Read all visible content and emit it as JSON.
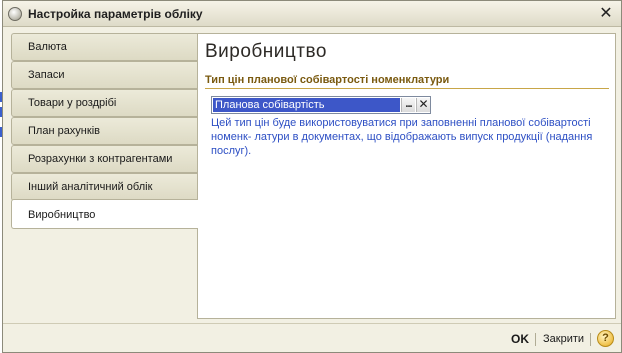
{
  "window": {
    "title": "Настройка параметрів обліку",
    "close_glyph": "✕",
    "app_icon": "app-logo-icon"
  },
  "tabs": [
    {
      "label": "Валюта"
    },
    {
      "label": "Запаси"
    },
    {
      "label": "Товари у роздрібі"
    },
    {
      "label": "План рахунків"
    },
    {
      "label": "Розрахунки з контрагентами"
    },
    {
      "label": "Інший аналітичний облік"
    },
    {
      "label": "Виробництво"
    }
  ],
  "active_tab_index": 6,
  "panel": {
    "title": "Виробництво",
    "group_header": "Тип цін планової собівартості номенклатури",
    "field_value": "Планова собівартість",
    "select_glyph": "...",
    "clear_glyph": "✕",
    "hint": "Цей тип цін буде використовуватися при заповненні планової собівартості номенк- латури в документах, що відображають випуск продукції (надання послуг)."
  },
  "footer": {
    "ok_label": "OK",
    "close_label": "Закрити",
    "help_glyph": "?"
  },
  "colors": {
    "window_bg": "#f2f0e3",
    "group_header": "#7a5a10",
    "hint_text": "#2d4fc4",
    "selection": "#3d57c8"
  }
}
